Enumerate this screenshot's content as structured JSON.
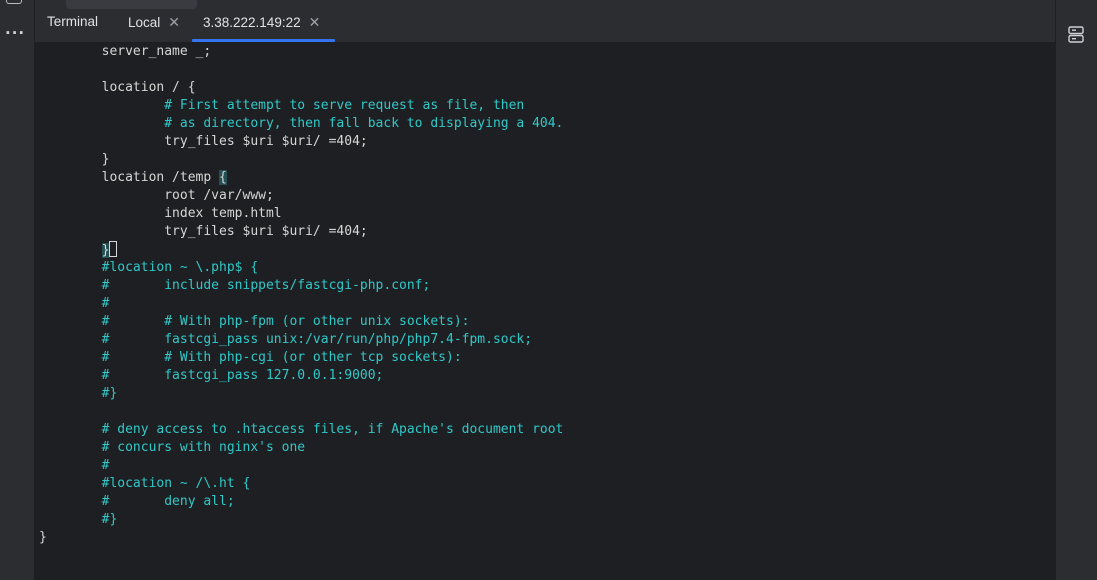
{
  "tool_window": {
    "title": "Terminal",
    "tabs": [
      {
        "label": "Local",
        "active": false
      },
      {
        "label": "3.38.222.149:22",
        "active": true
      }
    ]
  },
  "terminal": {
    "lines": [
      {
        "text": "        server_name _;",
        "kind": "code"
      },
      {
        "text": "",
        "kind": "code"
      },
      {
        "text": "        location / {",
        "kind": "code"
      },
      {
        "text": "                # First attempt to serve request as file, then",
        "kind": "comment"
      },
      {
        "text": "                # as directory, then fall back to displaying a 404.",
        "kind": "comment"
      },
      {
        "text": "                try_files $uri $uri/ =404;",
        "kind": "code"
      },
      {
        "text": "        }",
        "kind": "code"
      },
      {
        "text": "        location /temp {",
        "kind": "code"
      },
      {
        "text": "                root /var/www;",
        "kind": "code"
      },
      {
        "text": "                index temp.html",
        "kind": "code"
      },
      {
        "text": "                try_files $uri $uri/ =404;",
        "kind": "code"
      },
      {
        "text": "        }",
        "kind": "cursor"
      },
      {
        "text": "        #location ~ \\.php$ {",
        "kind": "comment"
      },
      {
        "text": "        #       include snippets/fastcgi-php.conf;",
        "kind": "comment"
      },
      {
        "text": "        #",
        "kind": "comment"
      },
      {
        "text": "        #       # With php-fpm (or other unix sockets):",
        "kind": "comment"
      },
      {
        "text": "        #       fastcgi_pass unix:/var/run/php/php7.4-fpm.sock;",
        "kind": "comment"
      },
      {
        "text": "        #       # With php-cgi (or other tcp sockets):",
        "kind": "comment"
      },
      {
        "text": "        #       fastcgi_pass 127.0.0.1:9000;",
        "kind": "comment"
      },
      {
        "text": "        #}",
        "kind": "comment"
      },
      {
        "text": "",
        "kind": "code"
      },
      {
        "text": "        # deny access to .htaccess files, if Apache's document root",
        "kind": "comment"
      },
      {
        "text": "        # concurs with nginx's one",
        "kind": "comment"
      },
      {
        "text": "        #",
        "kind": "comment"
      },
      {
        "text": "        #location ~ /\\.ht {",
        "kind": "comment"
      },
      {
        "text": "        #       deny all;",
        "kind": "comment"
      },
      {
        "text": "        #}",
        "kind": "comment"
      },
      {
        "text": "}",
        "kind": "code"
      }
    ]
  },
  "icons": {
    "left_more": "more-horizontal-icon",
    "right_db": "database-icon"
  },
  "colors": {
    "background": "#1e1f22",
    "text": "#d6d6d6",
    "comment": "#31c8c8",
    "accent": "#3574f0"
  }
}
